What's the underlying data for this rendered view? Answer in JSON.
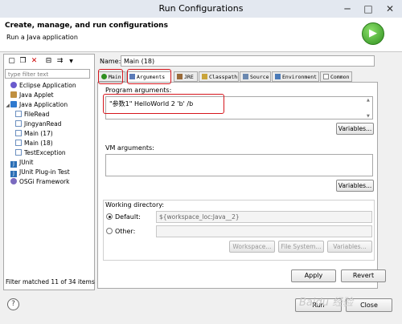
{
  "window": {
    "title": "Run Configurations",
    "minimize": "─",
    "maximize": "□",
    "close": "✕"
  },
  "header": {
    "title": "Create, manage, and run configurations",
    "subtitle": "Run a Java application"
  },
  "left": {
    "toolbar_icons": [
      "new-config-icon",
      "duplicate-icon",
      "delete-icon",
      "collapse-all-icon",
      "filter-icon",
      "menu-dropdown-icon"
    ],
    "filter_placeholder": "type filter text",
    "tree": [
      {
        "label": "Eclipse Application",
        "icon": "eclipse-app-icon",
        "level": 0,
        "expanded": false
      },
      {
        "label": "Java Applet",
        "icon": "java-applet-icon",
        "level": 0,
        "expanded": false
      },
      {
        "label": "Java Application",
        "icon": "java-application-icon",
        "level": 0,
        "expanded": true
      },
      {
        "label": "FileRead",
        "icon": "config-icon",
        "level": 1
      },
      {
        "label": "JingyanRead",
        "icon": "config-icon",
        "level": 1
      },
      {
        "label": "Main (17)",
        "icon": "config-icon",
        "level": 1
      },
      {
        "label": "Main (18)",
        "icon": "config-icon",
        "level": 1
      },
      {
        "label": "TestException",
        "icon": "config-icon",
        "level": 1
      },
      {
        "label": "JUnit",
        "icon": "junit-icon",
        "level": 0
      },
      {
        "label": "JUnit Plug-in Test",
        "icon": "junit-plugin-icon",
        "level": 0
      },
      {
        "label": "OSGi Framework",
        "icon": "osgi-icon",
        "level": 0
      }
    ],
    "status": "Filter matched 11 of 34 items"
  },
  "config": {
    "name_label": "Name:",
    "name_value": "Main (18)",
    "tabs": [
      "Main",
      "Arguments",
      "JRE",
      "Classpath",
      "Source",
      "Environment",
      "Common"
    ],
    "active_tab": "Arguments",
    "program_args_label": "Program arguments:",
    "program_args_value": "\"参数1\"   HelloWorld   2   'b'   /b",
    "variables_label": "Variables...",
    "vm_args_label": "VM arguments:",
    "vm_args_value": "",
    "working_dir": {
      "label": "Working directory:",
      "default_label": "Default:",
      "default_value": "${workspace_loc:Java__2}",
      "other_label": "Other:",
      "other_value": "",
      "workspace_btn": "Workspace...",
      "filesystem_btn": "File System...",
      "variables_btn": "Variables..."
    },
    "apply": "Apply",
    "revert": "Revert"
  },
  "footer": {
    "help": "?",
    "run": "Run",
    "close": "Close"
  },
  "watermark": "Baidu 经验",
  "colors": {
    "annotation_red": "#d6161d",
    "run_green": "#2f8f1f"
  }
}
